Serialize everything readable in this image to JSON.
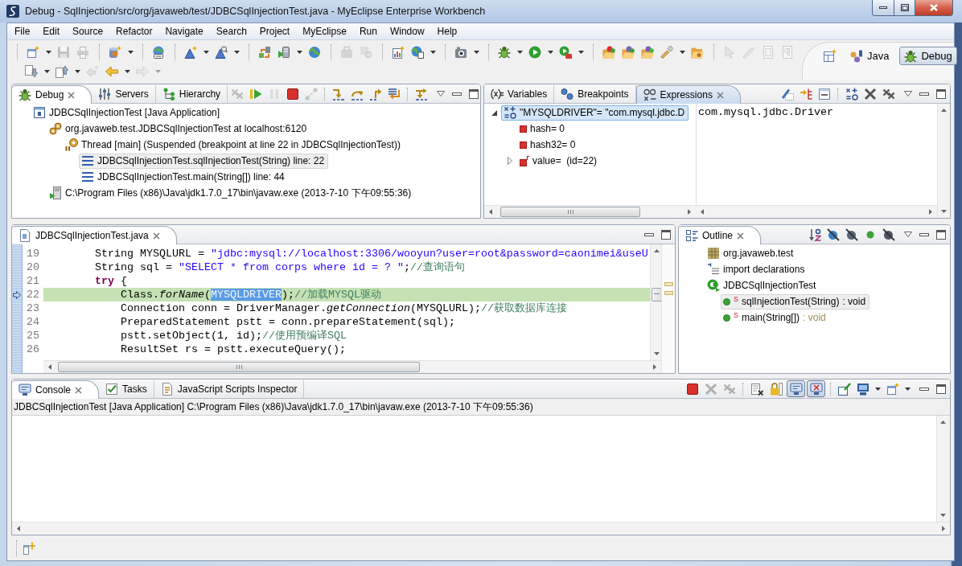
{
  "window": {
    "title": "Debug - SqlInjection/src/org/javaweb/test/JDBCSqlInjectionTest.java - MyEclipse Enterprise Workbench"
  },
  "menu": [
    "File",
    "Edit",
    "Source",
    "Refactor",
    "Navigate",
    "Search",
    "Project",
    "MyEclipse",
    "Run",
    "Window",
    "Help"
  ],
  "toolbar": {
    "rows": [
      [
        {
          "kind": "separator"
        },
        {
          "kind": "new-file",
          "disabled": false
        },
        {
          "kind": "dropdown",
          "disabled": false
        },
        {
          "kind": "save",
          "disabled": true
        },
        {
          "kind": "print",
          "disabled": true
        },
        {
          "kind": "separator"
        },
        {
          "kind": "new-project",
          "disabled": false
        },
        {
          "kind": "dropdown",
          "disabled": false
        },
        {
          "kind": "separator"
        },
        {
          "kind": "web-project",
          "disabled": false
        },
        {
          "kind": "separator"
        },
        {
          "kind": "new-model",
          "disabled": false
        },
        {
          "kind": "dropdown",
          "disabled": false
        },
        {
          "kind": "open-model",
          "disabled": false
        },
        {
          "kind": "dropdown",
          "disabled": false
        },
        {
          "kind": "separator"
        },
        {
          "kind": "deploy",
          "disabled": false
        },
        {
          "kind": "run-server",
          "disabled": false
        },
        {
          "kind": "dropdown",
          "disabled": false
        },
        {
          "kind": "browser",
          "disabled": false
        },
        {
          "kind": "separator"
        },
        {
          "kind": "export",
          "disabled": true
        },
        {
          "kind": "restore",
          "disabled": true
        },
        {
          "kind": "separator"
        },
        {
          "kind": "report",
          "disabled": false
        },
        {
          "kind": "web-browser",
          "disabled": false
        },
        {
          "kind": "dropdown",
          "disabled": false
        },
        {
          "kind": "separator"
        },
        {
          "kind": "snapshot",
          "disabled": false
        },
        {
          "kind": "dropdown",
          "disabled": false
        },
        {
          "kind": "separator"
        },
        {
          "kind": "debug",
          "disabled": false
        },
        {
          "kind": "dropdown",
          "disabled": false
        },
        {
          "kind": "run",
          "disabled": false
        },
        {
          "kind": "dropdown",
          "disabled": false
        },
        {
          "kind": "run-external",
          "disabled": false
        },
        {
          "kind": "dropdown",
          "disabled": false
        },
        {
          "kind": "separator"
        },
        {
          "kind": "open-type",
          "disabled": false
        },
        {
          "kind": "open-resource",
          "disabled": false
        },
        {
          "kind": "open-task",
          "disabled": false
        },
        {
          "kind": "search",
          "disabled": false
        },
        {
          "kind": "dropdown",
          "disabled": false
        },
        {
          "kind": "open-file",
          "disabled": false
        },
        {
          "kind": "separator"
        },
        {
          "kind": "toggle-hover",
          "disabled": true
        },
        {
          "kind": "toggle-mark",
          "disabled": true
        },
        {
          "kind": "toggle-block",
          "disabled": true
        },
        {
          "kind": "whitespace",
          "disabled": true
        }
      ],
      [
        {
          "kind": "next-annotation",
          "disabled": false
        },
        {
          "kind": "dropdown",
          "disabled": false
        },
        {
          "kind": "prev-annotation",
          "disabled": false
        },
        {
          "kind": "dropdown",
          "disabled": false
        },
        {
          "kind": "last-edit",
          "disabled": true
        },
        {
          "kind": "back",
          "disabled": false
        },
        {
          "kind": "dropdown",
          "disabled": false
        },
        {
          "kind": "forward",
          "disabled": true
        },
        {
          "kind": "dropdown",
          "disabled": true
        }
      ]
    ]
  },
  "perspectives": [
    {
      "kind": "java",
      "label": "Java",
      "selected": false
    },
    {
      "kind": "debug",
      "label": "Debug",
      "selected": true
    }
  ],
  "debug_view": {
    "focused": false,
    "tabs": [
      {
        "kind": "debug",
        "label": "Debug",
        "selected": true
      },
      {
        "kind": "servers",
        "label": "Servers",
        "selected": false
      },
      {
        "kind": "hierarchy",
        "label": "Hierarchy",
        "selected": false
      }
    ],
    "toolbar": [
      {
        "kind": "remove-terminated",
        "disabled": true
      },
      {
        "kind": "resume",
        "disabled": false
      },
      {
        "kind": "suspend",
        "disabled": true
      },
      {
        "kind": "terminate",
        "disabled": false
      },
      {
        "kind": "disconnect",
        "disabled": true
      },
      {
        "kind": "separator"
      },
      {
        "kind": "step-into",
        "disabled": false
      },
      {
        "kind": "step-over",
        "disabled": false
      },
      {
        "kind": "step-return",
        "disabled": false
      },
      {
        "kind": "drop-frame",
        "disabled": false
      },
      {
        "kind": "separator"
      },
      {
        "kind": "step-filters",
        "disabled": false
      }
    ],
    "tree": [
      {
        "kind": "launch",
        "label": "JDBCSqlInjectionTest [Java Application]",
        "selected": false,
        "children": [
          {
            "kind": "target",
            "label": "org.javaweb.test.JDBCSqlInjectionTest at localhost:6120",
            "selected": false,
            "children": [
              {
                "kind": "thread",
                "label": "Thread [main] (Suspended (breakpoint at line 22 in JDBCSqlInjectionTest))",
                "selected": false,
                "children": [
                  {
                    "kind": "frame",
                    "label": "JDBCSqlInjectionTest.sqlInjectionTest(String) line: 22",
                    "selected": true
                  },
                  {
                    "kind": "frame",
                    "label": "JDBCSqlInjectionTest.main(String[]) line: 44",
                    "selected": false
                  }
                ]
              }
            ]
          },
          {
            "kind": "process",
            "label": "C:\\Program Files (x86)\\Java\\jdk1.7.0_17\\bin\\javaw.exe (2013-7-10 下午09:55:36)",
            "selected": false
          }
        ]
      }
    ]
  },
  "expressions_view": {
    "focused": true,
    "tabs": [
      {
        "kind": "variables",
        "label": "Variables",
        "selected": false
      },
      {
        "kind": "breakpoints",
        "label": "Breakpoints",
        "selected": false
      },
      {
        "kind": "expressions",
        "label": "Expressions",
        "selected": true
      }
    ],
    "toolbar": [
      {
        "kind": "type-names",
        "disabled": false
      },
      {
        "kind": "logical-structure",
        "disabled": false
      },
      {
        "kind": "collapse-all",
        "disabled": false
      },
      {
        "kind": "separator"
      },
      {
        "kind": "add-watch",
        "disabled": false
      },
      {
        "kind": "remove",
        "disabled": false
      },
      {
        "kind": "remove-all",
        "disabled": false
      }
    ],
    "tree": [
      {
        "kind": "expression",
        "label": "\"MYSQLDRIVER\"= \"com.mysql.jdbc.D",
        "expanded": true,
        "selected": true,
        "children": [
          {
            "kind": "field",
            "label": "hash= 0",
            "selected": false
          },
          {
            "kind": "field",
            "label": "hash32= 0",
            "selected": false
          },
          {
            "kind": "array",
            "label": "value=  (id=22)",
            "expanded": false,
            "selected": false
          }
        ]
      }
    ],
    "detail": "com.mysql.jdbc.Driver"
  },
  "editor": {
    "focused": false,
    "tabs": [
      {
        "kind": "java-file",
        "label": "JDBCSqlInjectionTest.java",
        "selected": true
      }
    ],
    "lines": [
      {
        "number": "19",
        "current": false,
        "tokens": [
          {
            "kind": "plain",
            "text": "        String MYSQLURL = "
          },
          {
            "kind": "string",
            "text": "\"jdbc:mysql://localhost:3306/wooyun?user=root&password=caonimei&useU"
          }
        ]
      },
      {
        "number": "20",
        "current": false,
        "tokens": [
          {
            "kind": "plain",
            "text": "        String sql = "
          },
          {
            "kind": "string",
            "text": "\"SELECT * from corps where id = ? \""
          },
          {
            "kind": "plain",
            "text": ";"
          },
          {
            "kind": "comment",
            "text": "//查询语句"
          }
        ]
      },
      {
        "number": "21",
        "current": false,
        "tokens": [
          {
            "kind": "keyword",
            "text": "        try"
          },
          {
            "kind": "plain",
            "text": " {"
          }
        ]
      },
      {
        "number": "22",
        "current": true,
        "tokens": [
          {
            "kind": "plain",
            "text": "            Class."
          },
          {
            "kind": "static",
            "text": "forName"
          },
          {
            "kind": "plain",
            "text": "("
          },
          {
            "kind": "selection",
            "text": "MYSQLDRIVER"
          },
          {
            "kind": "plain",
            "text": ");"
          },
          {
            "kind": "comment",
            "text": "//加载MYSQL驱动"
          }
        ]
      },
      {
        "number": "23",
        "current": false,
        "tokens": [
          {
            "kind": "plain",
            "text": "            Connection conn = DriverManager."
          },
          {
            "kind": "static",
            "text": "getConnection"
          },
          {
            "kind": "plain",
            "text": "(MYSQLURL);"
          },
          {
            "kind": "comment",
            "text": "//获取数据库连接"
          }
        ]
      },
      {
        "number": "24",
        "current": false,
        "tokens": [
          {
            "kind": "plain",
            "text": "            PreparedStatement pstt = conn.prepareStatement(sql);"
          }
        ]
      },
      {
        "number": "25",
        "current": false,
        "tokens": [
          {
            "kind": "plain",
            "text": "            pstt.setObject(1, id);"
          },
          {
            "kind": "comment",
            "text": "//使用预编译SQL"
          }
        ]
      },
      {
        "number": "26",
        "current": false,
        "tokens": [
          {
            "kind": "plain",
            "text": "            ResultSet rs = pstt.executeQuery();"
          }
        ]
      }
    ]
  },
  "outline": {
    "focused": false,
    "tabs": [
      {
        "kind": "outline",
        "label": "Outline",
        "selected": true
      }
    ],
    "toolbar": [
      {
        "kind": "sort",
        "disabled": false
      },
      {
        "kind": "hide-fields",
        "disabled": false
      },
      {
        "kind": "hide-static",
        "disabled": false
      },
      {
        "kind": "hide-nonpublic",
        "disabled": false
      },
      {
        "kind": "hide-local",
        "disabled": false
      }
    ],
    "tree": [
      {
        "kind": "package",
        "label": "org.javaweb.test",
        "selected": false
      },
      {
        "kind": "imports",
        "label": "import declarations",
        "selected": false
      },
      {
        "kind": "class",
        "label": "JDBCSqlInjectionTest",
        "selected": false,
        "children": [
          {
            "kind": "method",
            "modifier": "S",
            "label": "sqlInjectionTest(String)",
            "type": ": void",
            "selected": true
          },
          {
            "kind": "method",
            "modifier": "S",
            "label": "main(String[])",
            "type": ": void",
            "selected": false
          }
        ]
      }
    ]
  },
  "console": {
    "focused": false,
    "tabs": [
      {
        "kind": "console",
        "label": "Console",
        "selected": true
      },
      {
        "kind": "tasks",
        "label": "Tasks",
        "selected": false
      },
      {
        "kind": "inspector",
        "label": "JavaScript Scripts Inspector",
        "selected": false
      }
    ],
    "toolbar": [
      {
        "kind": "terminate",
        "disabled": false
      },
      {
        "kind": "remove",
        "disabled": true
      },
      {
        "kind": "remove-all",
        "disabled": true
      },
      {
        "kind": "separator"
      },
      {
        "kind": "clear",
        "disabled": false
      },
      {
        "kind": "scroll-lock",
        "disabled": false,
        "on": false
      },
      {
        "kind": "show-stdout",
        "disabled": false,
        "on": true
      },
      {
        "kind": "show-stderr",
        "disabled": false,
        "on": true
      },
      {
        "kind": "separator"
      },
      {
        "kind": "pin",
        "disabled": false
      },
      {
        "kind": "display",
        "disabled": false
      },
      {
        "kind": "dropdown",
        "disabled": false
      },
      {
        "kind": "open-console",
        "disabled": false
      },
      {
        "kind": "dropdown",
        "disabled": false
      }
    ],
    "header": "JDBCSqlInjectionTest [Java Application] C:\\Program Files (x86)\\Java\\jdk1.7.0_17\\bin\\javaw.exe (2013-7-10 下午09:55:36)"
  }
}
